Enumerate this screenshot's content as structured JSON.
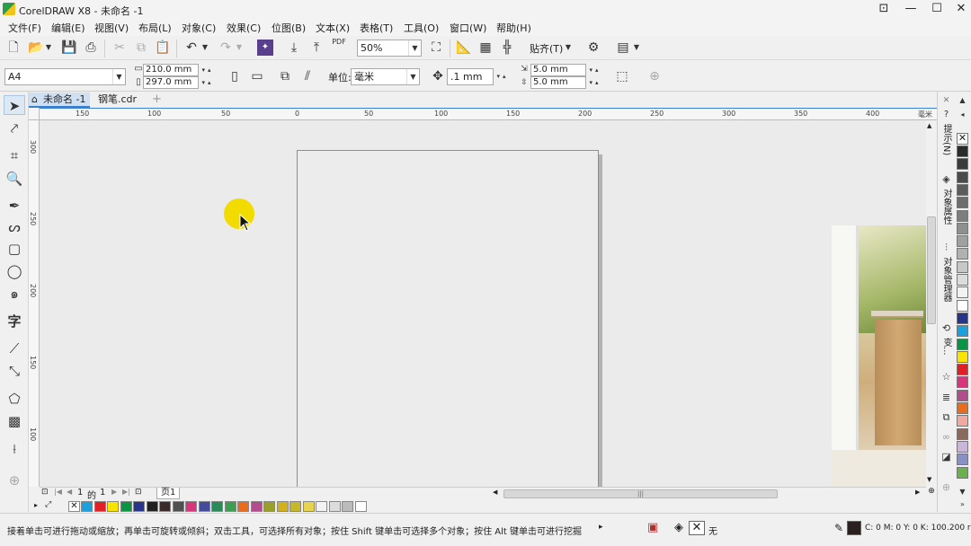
{
  "window": {
    "title": "CorelDRAW X8 - 未命名 -1"
  },
  "menu": [
    "文件(F)",
    "编辑(E)",
    "视图(V)",
    "布局(L)",
    "对象(C)",
    "效果(C)",
    "位图(B)",
    "文本(X)",
    "表格(T)",
    "工具(O)",
    "窗口(W)",
    "帮助(H)"
  ],
  "toolbar": {
    "zoom": "50%",
    "snap_label": "贴齐(T)",
    "pdf_label": "PDF"
  },
  "property_bar": {
    "paper_size": "A4",
    "width": "210.0 mm",
    "height": "297.0 mm",
    "units_label": "单位:",
    "units_value": "毫米",
    "nudge": ".1 mm",
    "dup_x": "5.0 mm",
    "dup_y": "5.0 mm"
  },
  "doc_tabs": [
    "未命名 -1",
    "钢笔.cdr"
  ],
  "rulers": {
    "h_ticks": [
      "150",
      "100",
      "50",
      "0",
      "50",
      "100",
      "150",
      "200",
      "250",
      "300",
      "350",
      "400"
    ],
    "h_unit": "毫米",
    "v_ticks": [
      "300",
      "250",
      "200",
      "150",
      "100"
    ]
  },
  "page_nav": {
    "current": "1",
    "of_label": "的",
    "total": "1",
    "page_tab": "页1"
  },
  "dockers": [
    "提示(N)",
    "对象属性",
    "对象管理器",
    "变..."
  ],
  "status": {
    "hint": "接着单击可进行拖动或缩放；再单击可旋转或倾斜；双击工具，可选择所有对象；按住 Shift 键单击可选择多个对象；按住 Alt 键单击可进行挖掘",
    "fill_label": "无",
    "color_readout": "C: 0 M: 0 Y: 0 K: 100",
    "outline_width": ".200 r"
  },
  "doc_palette_colors": [
    "#1aa0dc",
    "#e11f26",
    "#f7e400",
    "#0a9545",
    "#27348b",
    "#202020",
    "#3a2a2a",
    "#505050",
    "#d7357c",
    "#434d9c",
    "#2a8a5a",
    "#3d9e4f",
    "#e96d1f",
    "#b24e8d",
    "#9a9e2a",
    "#d0b21c",
    "#c7b82a",
    "#e6d44e",
    "#f3f3f3",
    "#dcdcdc",
    "#bbbbbb",
    "#ffffff"
  ],
  "palette_colors": [
    "#2b2b2b",
    "#3b3b3b",
    "#4b4b4b",
    "#5c5c5c",
    "#6d6d6d",
    "#7e7e7e",
    "#8f8f8f",
    "#a0a0a0",
    "#b1b1b1",
    "#c7c7c7",
    "#dcdcdc",
    "#f2f2f2",
    "#ffffff",
    "#27348b",
    "#1aa0dc",
    "#0a9545",
    "#f7e400",
    "#e11f26",
    "#d7357c",
    "#b24e8d",
    "#e96d1f",
    "#f0a9a0",
    "#8a6a5a",
    "#c9b6d8",
    "#8890c4",
    "#6ab04c"
  ]
}
